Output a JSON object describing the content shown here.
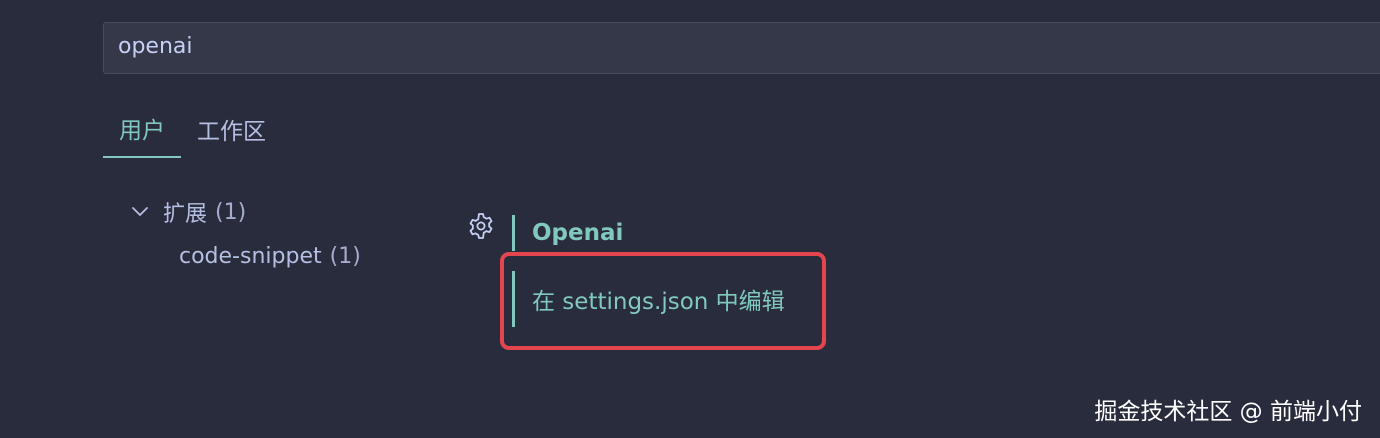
{
  "search": {
    "value": "openai"
  },
  "tabs": [
    {
      "label": "用户",
      "active": true
    },
    {
      "label": "工作区",
      "active": false
    }
  ],
  "tree": {
    "group": {
      "label": "扩展",
      "count": "(1)",
      "icon": "chevron-down-icon"
    },
    "child": {
      "label": "code-snippet",
      "count": "(1)"
    }
  },
  "setting": {
    "gear_icon": "gear-icon",
    "title": "Openai",
    "edit_link": "在 settings.json 中编辑"
  },
  "highlight": {
    "color": "#e5454e"
  },
  "watermark": "掘金技术社区 @ 前端小付",
  "colors": {
    "background": "#292c3c",
    "accent": "#81c8be",
    "input_bg": "#353849"
  }
}
